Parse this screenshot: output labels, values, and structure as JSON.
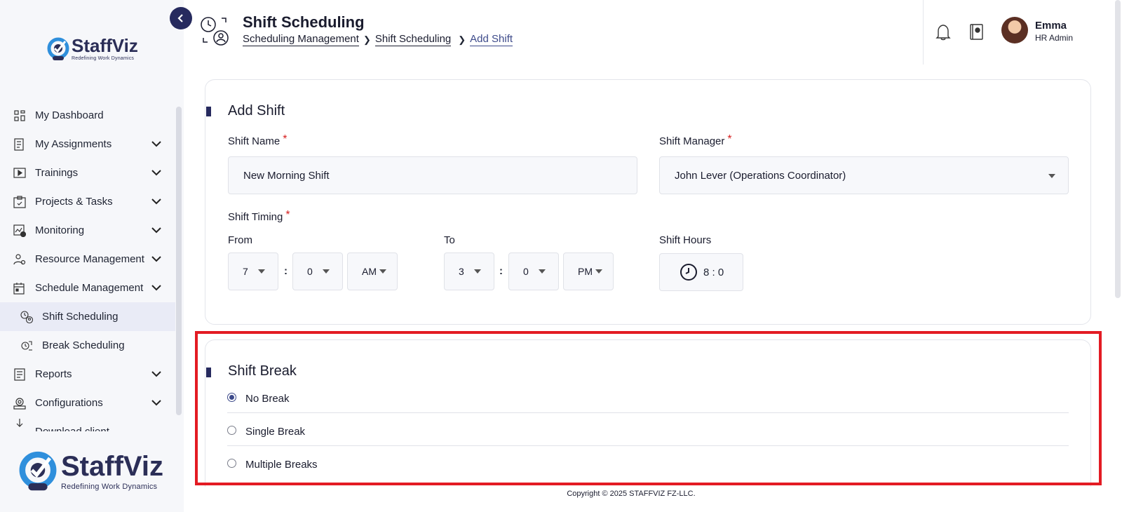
{
  "brand": {
    "name": "StaffViz",
    "tagline_small": "Redefining Work Dynamics",
    "tagline_large": "Redefining Work Dynamics"
  },
  "sidebar": {
    "items": [
      {
        "label": "My Dashboard",
        "icon": "dashboard-icon",
        "has_chevron": false
      },
      {
        "label": "My Assignments",
        "icon": "assignments-icon",
        "has_chevron": true
      },
      {
        "label": "Trainings",
        "icon": "play-icon",
        "has_chevron": true
      },
      {
        "label": "Projects & Tasks",
        "icon": "clipboard-icon",
        "has_chevron": true
      },
      {
        "label": "Monitoring",
        "icon": "monitoring-icon",
        "has_chevron": true
      },
      {
        "label": "Resource Management",
        "icon": "resource-icon",
        "has_chevron": true
      },
      {
        "label": "Schedule Management",
        "icon": "calendar-icon",
        "has_chevron": true
      },
      {
        "label": "Shift Scheduling",
        "icon": "shift-icon",
        "sub": true,
        "active": true
      },
      {
        "label": "Break Scheduling",
        "icon": "break-icon",
        "sub": true
      },
      {
        "label": "Reports",
        "icon": "reports-icon",
        "has_chevron": true
      },
      {
        "label": "Configurations",
        "icon": "configurations-icon",
        "has_chevron": true
      },
      {
        "label": "Download client",
        "icon": "download-icon",
        "has_chevron": false
      }
    ]
  },
  "header": {
    "title": "Shift Scheduling",
    "breadcrumb": [
      "Scheduling Management",
      "Shift Scheduling",
      "Add Shift"
    ],
    "user": {
      "name": "Emma",
      "role": "HR Admin"
    }
  },
  "add_shift": {
    "section_title": "Add Shift",
    "shift_name_label": "Shift Name",
    "shift_name_value": "New Morning Shift",
    "shift_manager_label": "Shift Manager",
    "shift_manager_value": "John Lever (Operations Coordinator)",
    "shift_timing_label": "Shift Timing",
    "from_label": "From",
    "to_label": "To",
    "shift_hours_label": "Shift Hours",
    "from": {
      "hour": "7",
      "minute": "0",
      "meridiem": "AM"
    },
    "to": {
      "hour": "3",
      "minute": "0",
      "meridiem": "PM"
    },
    "shift_hours_value": "8 : 0",
    "colon": ":",
    "required_mark": "*"
  },
  "shift_break": {
    "section_title": "Shift Break",
    "options": [
      "No Break",
      "Single Break",
      "Multiple Breaks"
    ],
    "selected": "No Break"
  },
  "footer": {
    "copyright": "Copyright © 2025 STAFFVIZ FZ-LLC."
  },
  "colors": {
    "primary": "#262a5e",
    "accent": "#3d4a8a",
    "required": "#d62020",
    "highlight": "#e31b23"
  }
}
